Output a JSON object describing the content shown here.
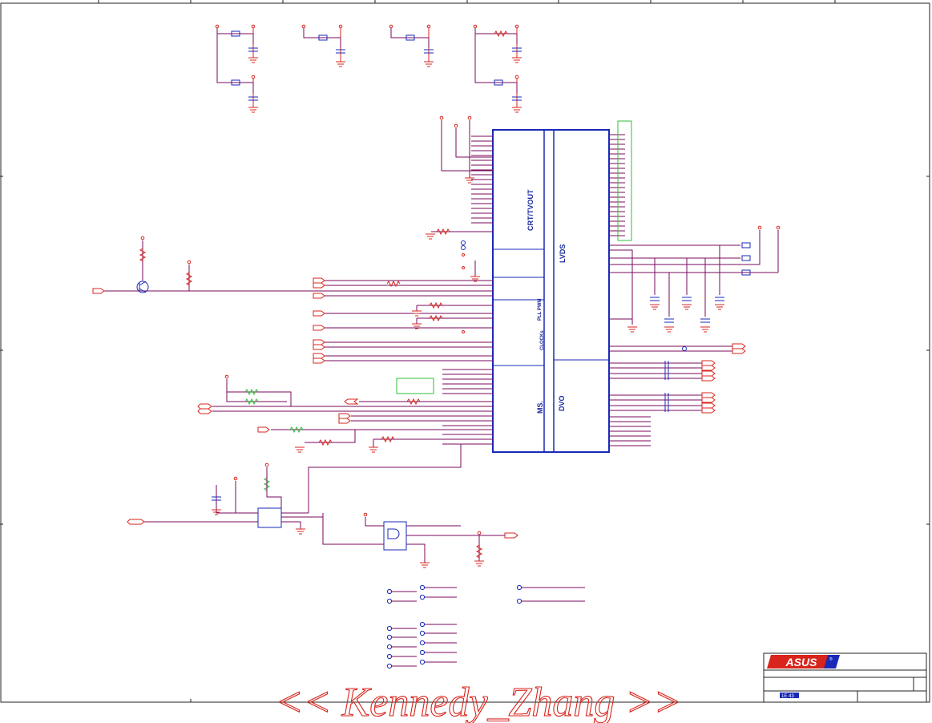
{
  "chip_sections": {
    "crt_tvout": "CRT/TVOUT",
    "lvds": "LVDS",
    "pll_pwm": "PLL PWM",
    "clocks": "CLOCKs",
    "ms": "MS.",
    "dvo": "DVO"
  },
  "title_block": {
    "logo_text": "ASUS",
    "registered": "®",
    "sheet_ref": "1E 43"
  },
  "watermark": "<< Kennedy_Zhang >>",
  "colors": {
    "wire": "#7a0a5c",
    "part": "#d9241c",
    "chip": "#1a2ab8",
    "label": "#1a2a9c",
    "frame": "#222222",
    "connector_box": "#2fbf3a"
  }
}
